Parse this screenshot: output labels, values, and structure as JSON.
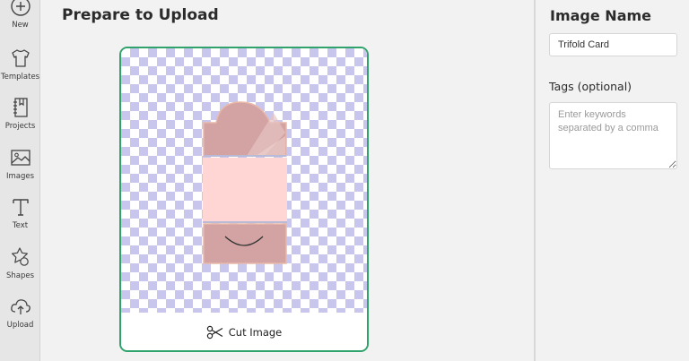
{
  "sidebar": {
    "items": [
      {
        "label": "New",
        "icon": "plus-circle-icon"
      },
      {
        "label": "Templates",
        "icon": "tshirt-icon"
      },
      {
        "label": "Projects",
        "icon": "notebook-icon"
      },
      {
        "label": "Images",
        "icon": "image-icon"
      },
      {
        "label": "Text",
        "icon": "text-t-icon"
      },
      {
        "label": "Shapes",
        "icon": "shapes-icon"
      },
      {
        "label": "Upload",
        "icon": "cloud-upload-icon"
      }
    ]
  },
  "main": {
    "title": "Prepare to Upload",
    "preview": {
      "cut_label": "Cut Image",
      "cut_icon": "scissors-icon"
    }
  },
  "panel": {
    "image_name_heading": "Image Name",
    "image_name_value": "Trifold Card",
    "tags_label": "Tags (optional)",
    "tags_placeholder": "Enter keywords separated by a comma"
  },
  "colors": {
    "accent_green": "#2fa36b",
    "checker_lavender": "#c9c6ee",
    "card_dark_pink": "#d3a3a3",
    "card_light_pink": "#ffd6d4",
    "card_outline": "#e8b8a8"
  }
}
